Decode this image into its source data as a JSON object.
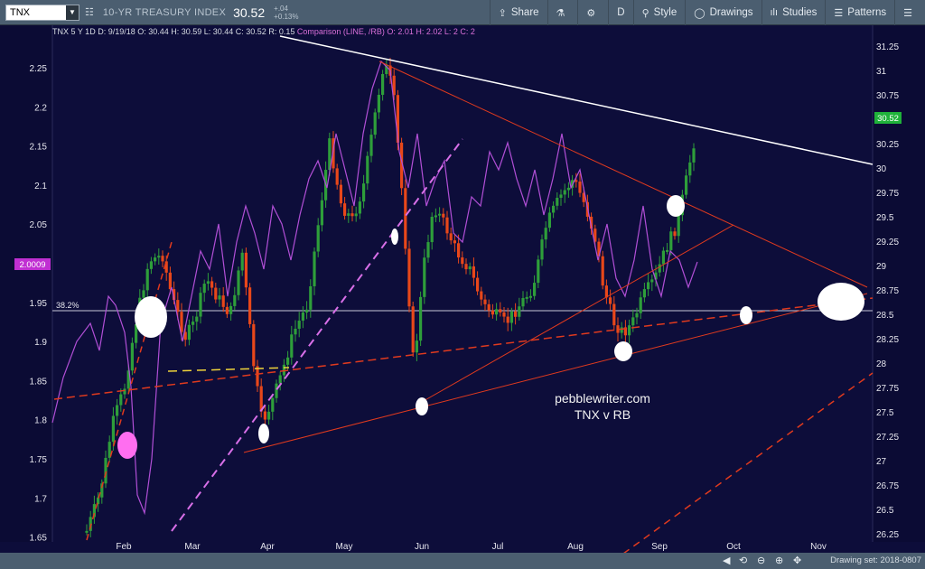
{
  "toolbar": {
    "symbol": "TNX",
    "title": "10-YR TREASURY INDEX",
    "price": "30.52",
    "change_abs": "+.04",
    "change_pct": "+0.13%",
    "buttons": {
      "share": "Share",
      "interval": "D",
      "style": "Style",
      "drawings": "Drawings",
      "studies": "Studies",
      "patterns": "Patterns"
    }
  },
  "info_bar": {
    "main": "TNX 5 Y 1D  D: 9/19/18  O: 30.44  H: 30.59  L: 30.44  C: 30.52  R: 0.15",
    "comparison": "Comparison (LINE, /RB)  O: 2.01  H: 2.02  L: 2  C: 2"
  },
  "left_axis": {
    "ticks": [
      "2.25",
      "2.2",
      "2.15",
      "2.1",
      "2.05",
      "2",
      "1.95",
      "1.9",
      "1.85",
      "1.8",
      "1.75",
      "1.7",
      "1.65"
    ],
    "current": "2.0009"
  },
  "right_axis": {
    "ticks": [
      "31.25",
      "31",
      "30.75",
      "30.5",
      "30.25",
      "30",
      "29.75",
      "29.5",
      "29.25",
      "29",
      "28.75",
      "28.5",
      "28.25",
      "28",
      "27.75",
      "27.5",
      "27.25",
      "27",
      "26.75",
      "26.5",
      "26.25"
    ],
    "current": "30.52"
  },
  "x_axis": {
    "months": [
      "Feb",
      "Mar",
      "Apr",
      "May",
      "Jun",
      "Jul",
      "Aug",
      "Sep",
      "Oct",
      "Nov"
    ]
  },
  "annotations": {
    "fib_label": "38.2%",
    "watermark_line1": "pebblewriter.com",
    "watermark_line2": "TNX v RB"
  },
  "bottom_bar": {
    "drawing_set": "Drawing set: 2018-0807"
  },
  "colors": {
    "background": "#0d0d3a",
    "up_candle": "#2e9e3a",
    "down_candle": "#e8471a",
    "comparison_line": "#b14fd6",
    "trend_red": "#e03a1e",
    "trend_white": "#ffffff",
    "price_badge": "#1fb23a"
  }
}
